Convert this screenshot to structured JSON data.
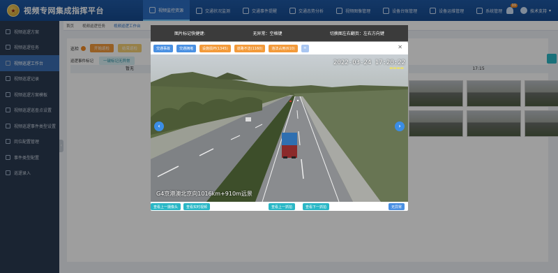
{
  "app": {
    "title": "视频专网集成指挥平台",
    "logo_icon": "police-badge-icon"
  },
  "topnav": [
    {
      "label": "视频监控资源",
      "icon": "camera-icon",
      "active": true
    },
    {
      "label": "交通状况监测",
      "icon": "traffic-icon",
      "active": false
    },
    {
      "label": "交通事件提醒",
      "icon": "alert-icon",
      "active": false
    },
    {
      "label": "交通态势分析",
      "icon": "chart-icon",
      "active": false
    },
    {
      "label": "视频图像管理",
      "icon": "image-icon",
      "active": false
    },
    {
      "label": "设备台账管理",
      "icon": "device-icon",
      "active": false
    },
    {
      "label": "设备运维管理",
      "icon": "tools-icon",
      "active": false
    },
    {
      "label": "系统管理",
      "icon": "settings-icon",
      "active": false
    }
  ],
  "user": {
    "badge_count": "99",
    "name": "技术支持"
  },
  "sidebar": [
    {
      "label": "视频巡逻方案",
      "active": false
    },
    {
      "label": "视频巡逻任务",
      "active": false
    },
    {
      "label": "视频巡逻工作台",
      "active": true
    },
    {
      "label": "视频巡逻记录",
      "active": false
    },
    {
      "label": "视频巡逻方案模板",
      "active": false
    },
    {
      "label": "视频巡逻巡查点设置",
      "active": false
    },
    {
      "label": "视频巡逻事件类型设置",
      "active": false
    },
    {
      "label": "岗位配置管理",
      "active": false
    },
    {
      "label": "事件类型配置",
      "active": false
    },
    {
      "label": "巡逻录入",
      "active": false
    }
  ],
  "breadcrumb": [
    "首页",
    "视频巡逻任务",
    "视频巡逻工作台"
  ],
  "panel": {
    "label": "巡检",
    "btn1": "开始巡检",
    "btn2": "结束巡检",
    "row2_label": "巡逻事件标记",
    "row2_tag": "一键标记无异常",
    "col_head_left": "暂无",
    "col_head_right": "17:15"
  },
  "infobar": {
    "hotkey_label": "图片标记快捷键:",
    "no_anomaly": "无异常：空格键",
    "switch_image": "切换图左右翻页：左右方向键"
  },
  "modal": {
    "toolbar": [
      {
        "label": "交通事故",
        "style": "blue"
      },
      {
        "label": "交通拥堵",
        "style": "blue"
      },
      {
        "label": "设施损坏(1345)",
        "style": "orange"
      },
      {
        "label": "道路不洁(1160)",
        "style": "orange"
      },
      {
        "label": "违法占用(610)",
        "style": "orange"
      }
    ],
    "more_icon": "chevron-down-icon",
    "close_icon": "close-icon",
    "timestamp": "2022-03-24 17:20:22",
    "caption": "G4京港澳北京向1016km+910m远景",
    "footer": {
      "prev_cam": "查看上一摄像头",
      "realtime": "查看实时视频",
      "prev_img": "查看上一抓拍",
      "next_img": "查看下一抓拍",
      "no_anomaly": "无异常"
    }
  }
}
